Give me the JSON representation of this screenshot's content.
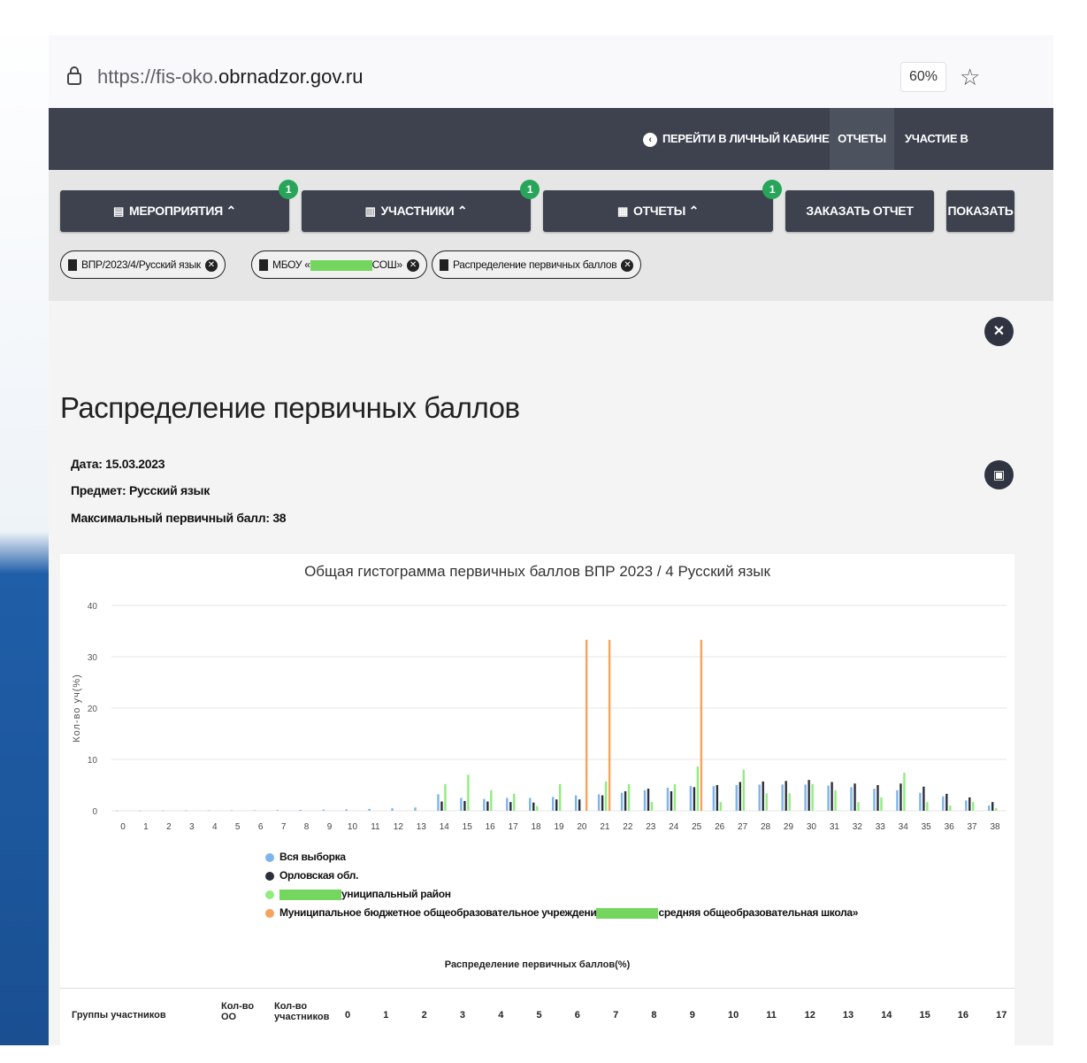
{
  "browser": {
    "url_prefix": "https://fis-oko.",
    "url_domain": "obrnadzor.gov.ru",
    "zoom": "60%"
  },
  "topnav": {
    "cabinet": "ПЕРЕЙТИ В ЛИЧНЫЙ КАБИНЕТ",
    "reports": "ОТЧЕТЫ",
    "events": "УЧАСТИЕ В МЕРОПРИЯТИЯХ"
  },
  "filters": {
    "events": "МЕРОПРИЯТИЯ",
    "events_badge": "1",
    "participants": "УЧАСТНИКИ",
    "participants_badge": "1",
    "reports": "ОТЧЕТЫ",
    "reports_badge": "1",
    "order_report": "ЗАКАЗАТЬ ОТЧЕТ",
    "show": "ПОКАЗАТЬ"
  },
  "chips": {
    "c1": "ВПР/2023/4/Русский язык",
    "c2_prefix": "МБОУ «",
    "c2_suffix": "СОШ»",
    "c3": "Распределение первичных баллов"
  },
  "report": {
    "title": "Распределение первичных баллов",
    "date": "Дата: 15.03.2023",
    "subject": "Предмет: Русский язык",
    "max_score": "Максимальный первичный балл: 38"
  },
  "chart_data": {
    "type": "bar",
    "title": "Общая гистограмма первичных баллов ВПР 2023 / 4 Русский язык",
    "xlabel": "",
    "ylabel": "Кол-во уч(%)",
    "ylim": [
      0,
      40
    ],
    "yticks": [
      0,
      10,
      20,
      30,
      40
    ],
    "categories": [
      "0",
      "1",
      "2",
      "3",
      "4",
      "5",
      "6",
      "7",
      "8",
      "9",
      "10",
      "11",
      "12",
      "13",
      "14",
      "15",
      "16",
      "17",
      "18",
      "19",
      "20",
      "21",
      "22",
      "23",
      "24",
      "25",
      "26",
      "27",
      "28",
      "29",
      "30",
      "31",
      "32",
      "33",
      "34",
      "35",
      "36",
      "37",
      "38"
    ],
    "series": [
      {
        "name": "Вся выборка",
        "color": "#7cb5ec",
        "values": [
          0.03,
          0.03,
          0.04,
          0.05,
          0.06,
          0.08,
          0.1,
          0.13,
          0.17,
          0.22,
          0.28,
          0.37,
          0.48,
          0.64,
          3.2,
          2.5,
          2.3,
          2.5,
          2.5,
          2.7,
          3.0,
          3.2,
          3.5,
          4.0,
          4.5,
          4.8,
          4.8,
          5.0,
          5.1,
          5.1,
          5.1,
          4.9,
          4.6,
          4.3,
          4.0,
          3.5,
          2.8,
          2.0,
          1.0
        ]
      },
      {
        "name": "Орловская обл.",
        "color": "#2b2f3a",
        "values": [
          0,
          0,
          0,
          0,
          0,
          0,
          0,
          0,
          0,
          0,
          0,
          0,
          0,
          0,
          1.8,
          1.9,
          1.8,
          1.7,
          1.6,
          2.2,
          2.2,
          3.0,
          3.8,
          4.3,
          3.8,
          4.6,
          5.0,
          5.6,
          5.7,
          5.8,
          6.0,
          5.6,
          5.3,
          5.0,
          5.3,
          4.7,
          3.3,
          2.6,
          1.7
        ]
      },
      {
        "name": "[скрыто] муниципальный район",
        "color": "#90ed7d",
        "values": [
          0,
          0,
          0,
          0,
          0,
          0,
          0,
          0,
          0,
          0,
          0,
          0,
          0,
          0,
          5.2,
          7.0,
          4.0,
          3.3,
          0.9,
          5.2,
          0,
          5.7,
          5.2,
          1.7,
          5.2,
          8.6,
          1.7,
          8.0,
          3.4,
          3.4,
          5.2,
          4.0,
          1.7,
          2.6,
          7.4,
          1.7,
          1.0,
          1.7,
          0.5
        ]
      },
      {
        "name": "Муниципальное бюджетное общеобразовательное учреждение [скрыто] средняя общеобразовательная школа»",
        "color": "#f7a35c",
        "values": [
          0,
          0,
          0,
          0,
          0,
          0,
          0,
          0,
          0,
          0,
          0,
          0,
          0,
          0,
          0,
          0,
          0,
          0,
          0,
          0,
          33.3,
          33.3,
          0,
          0,
          0,
          33.3,
          0,
          0,
          0,
          0,
          0,
          0,
          0,
          0,
          0,
          0,
          0,
          0,
          0
        ]
      }
    ],
    "legend_position": "bottom",
    "grid": true,
    "x_caption": "Распределение первичных баллов(%)"
  },
  "legend": {
    "l1": "Вся выборка",
    "l2": "Орловская обл.",
    "l3_suffix": "униципальный район",
    "l4_prefix": "Муниципальное бюджетное общеобразовательное учреждени",
    "l4_suffix": "средняя общеобразовательная школа»"
  },
  "table": {
    "col_groups": "Группы участников",
    "col_oo": "Кол-во ОО",
    "col_participants": "Кол-во участников",
    "score_columns": [
      "0",
      "1",
      "2",
      "3",
      "4",
      "5",
      "6",
      "7",
      "8",
      "9",
      "10",
      "11",
      "12",
      "13",
      "14",
      "15",
      "16",
      "17"
    ]
  },
  "colors": {
    "nav_bg": "#3d424e",
    "badge_green": "#27a55a",
    "series_blue": "#7cb5ec",
    "series_dark": "#2b2f3a",
    "series_green": "#90ed7d",
    "series_orange": "#f7a35c"
  }
}
